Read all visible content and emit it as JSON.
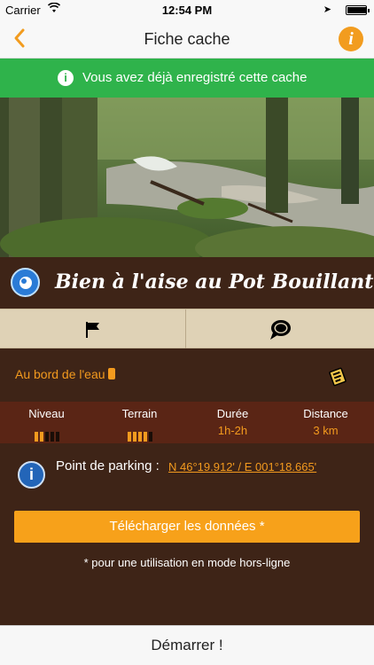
{
  "status_bar": {
    "carrier": "Carrier",
    "time": "12:54 PM",
    "battery_level": 0.95
  },
  "nav": {
    "title": "Fiche cache",
    "info_label": "i"
  },
  "banner": {
    "text": "Vous avez déjà enregistré cette cache",
    "icon": "info-icon",
    "color": "#2fb34b"
  },
  "cache": {
    "title": "Bien à l'aise au Pot Bouillant",
    "icon": "cache-type-icon"
  },
  "actions": [
    {
      "icon": "flag-icon"
    },
    {
      "icon": "chat-icon"
    }
  ],
  "tag": {
    "text": "Au bord de l'eau"
  },
  "stats": {
    "niveau": {
      "label": "Niveau",
      "level": 2,
      "max": 5
    },
    "terrain": {
      "label": "Terrain",
      "level": 4,
      "max": 5
    },
    "duree": {
      "label": "Durée",
      "value": "1h-2h"
    },
    "distance": {
      "label": "Distance",
      "value": "3 km"
    }
  },
  "parking": {
    "label": "Point de parking :",
    "coords": "N 46°19.912' / E 001°18.665'"
  },
  "download": {
    "label": "Télécharger les données *",
    "footnote": "* pour une utilisation en mode hors-ligne"
  },
  "start_button": "Démarrer !",
  "colors": {
    "accent": "#f7a11a",
    "background": "#3e2417",
    "stats_bg": "#5a2515"
  }
}
